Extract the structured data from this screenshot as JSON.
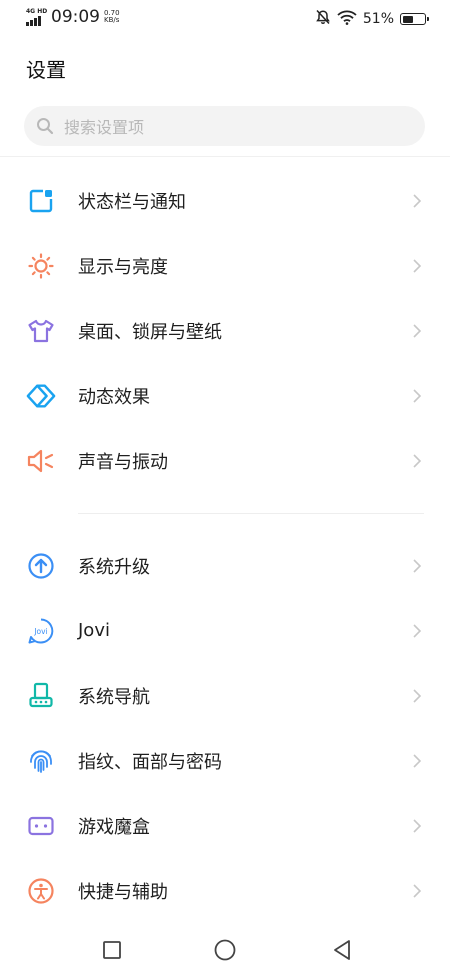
{
  "status_bar": {
    "network": "4G HD",
    "time": "09:09",
    "speed_value": "0.70",
    "speed_unit": "KB/s",
    "battery_percent": "51%",
    "battery_level": 0.51
  },
  "page": {
    "title": "设置"
  },
  "search": {
    "placeholder": "搜索设置项"
  },
  "groups": [
    {
      "items": [
        {
          "label": "状态栏与通知",
          "icon": "notification-icon",
          "color": "#1aa3f0"
        },
        {
          "label": "显示与亮度",
          "icon": "sun-icon",
          "color": "#f5845f"
        },
        {
          "label": "桌面、锁屏与壁纸",
          "icon": "tshirt-icon",
          "color": "#8b73e0"
        },
        {
          "label": "动态效果",
          "icon": "diamond-icon",
          "color": "#1aa3f0"
        },
        {
          "label": "声音与振动",
          "icon": "speaker-icon",
          "color": "#f5845f"
        }
      ]
    },
    {
      "items": [
        {
          "label": "系统升级",
          "icon": "upgrade-arrow-icon",
          "color": "#3b8ff5"
        },
        {
          "label": "Jovi",
          "icon": "jovi-icon",
          "color": "#3b8ff5",
          "icon_text": "Jovi"
        },
        {
          "label": "系统导航",
          "icon": "navigation-icon",
          "color": "#11b8a8"
        },
        {
          "label": "指纹、面部与密码",
          "icon": "fingerprint-icon",
          "color": "#3b8ff5"
        },
        {
          "label": "游戏魔盒",
          "icon": "gamepad-icon",
          "color": "#8b73e0"
        },
        {
          "label": "快捷与辅助",
          "icon": "accessibility-icon",
          "color": "#f5845f"
        }
      ]
    }
  ],
  "nav_bar": {
    "buttons": [
      "recents-icon",
      "home-icon",
      "back-icon"
    ]
  }
}
